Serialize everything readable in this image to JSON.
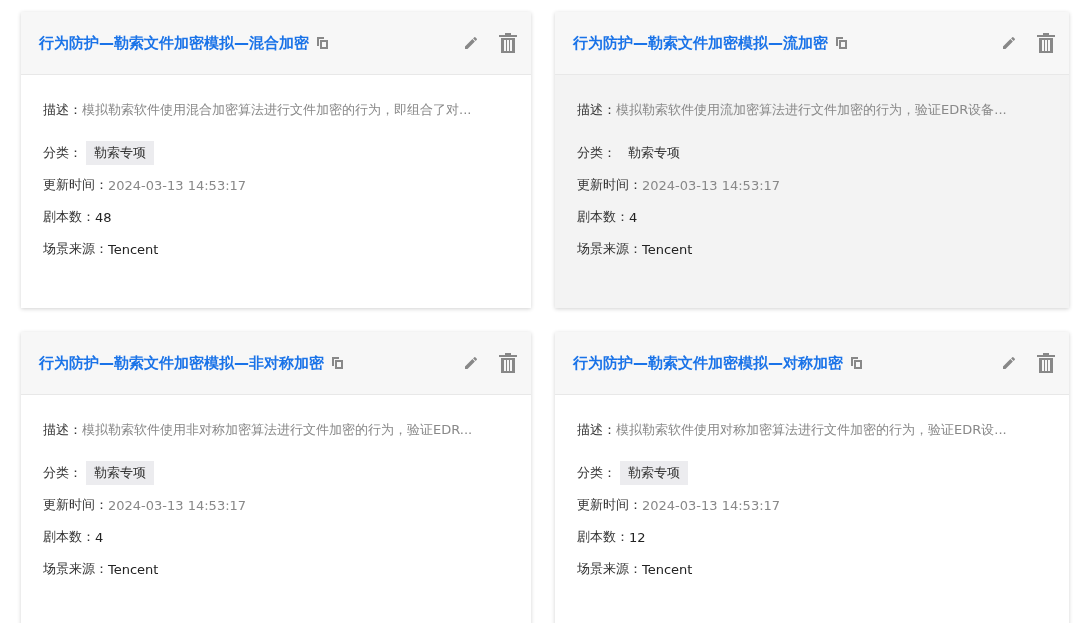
{
  "cards": [
    {
      "title": "行为防护—勒索文件加密模拟—混合加密",
      "hovered": false,
      "description_label": "描述：",
      "description": "模拟勒索软件使用混合加密算法进行文件加密的行为，即组合了对...",
      "category_label": "分类：",
      "category": "勒索专项",
      "updated_label": "更新时间：",
      "updated": "2024-03-13 14:53:17",
      "scripts_label": "剧本数：",
      "scripts": "48",
      "source_label": "场景来源：",
      "source": "Tencent"
    },
    {
      "title": "行为防护—勒索文件加密模拟—流加密",
      "hovered": true,
      "description_label": "描述：",
      "description": "模拟勒索软件使用流加密算法进行文件加密的行为，验证EDR设备...",
      "category_label": "分类：",
      "category": "勒索专项",
      "updated_label": "更新时间：",
      "updated": "2024-03-13 14:53:17",
      "scripts_label": "剧本数：",
      "scripts": "4",
      "source_label": "场景来源：",
      "source": "Tencent"
    },
    {
      "title": "行为防护—勒索文件加密模拟—非对称加密",
      "hovered": false,
      "description_label": "描述：",
      "description": "模拟勒索软件使用非对称加密算法进行文件加密的行为，验证EDR...",
      "category_label": "分类：",
      "category": "勒索专项",
      "updated_label": "更新时间：",
      "updated": "2024-03-13 14:53:17",
      "scripts_label": "剧本数：",
      "scripts": "4",
      "source_label": "场景来源：",
      "source": "Tencent"
    },
    {
      "title": "行为防护—勒索文件加密模拟—对称加密",
      "hovered": false,
      "description_label": "描述：",
      "description": "模拟勒索软件使用对称加密算法进行文件加密的行为，验证EDR设...",
      "category_label": "分类：",
      "category": "勒索专项",
      "updated_label": "更新时间：",
      "updated": "2024-03-13 14:53:17",
      "scripts_label": "剧本数：",
      "scripts": "12",
      "source_label": "场景来源：",
      "source": "Tencent"
    }
  ]
}
